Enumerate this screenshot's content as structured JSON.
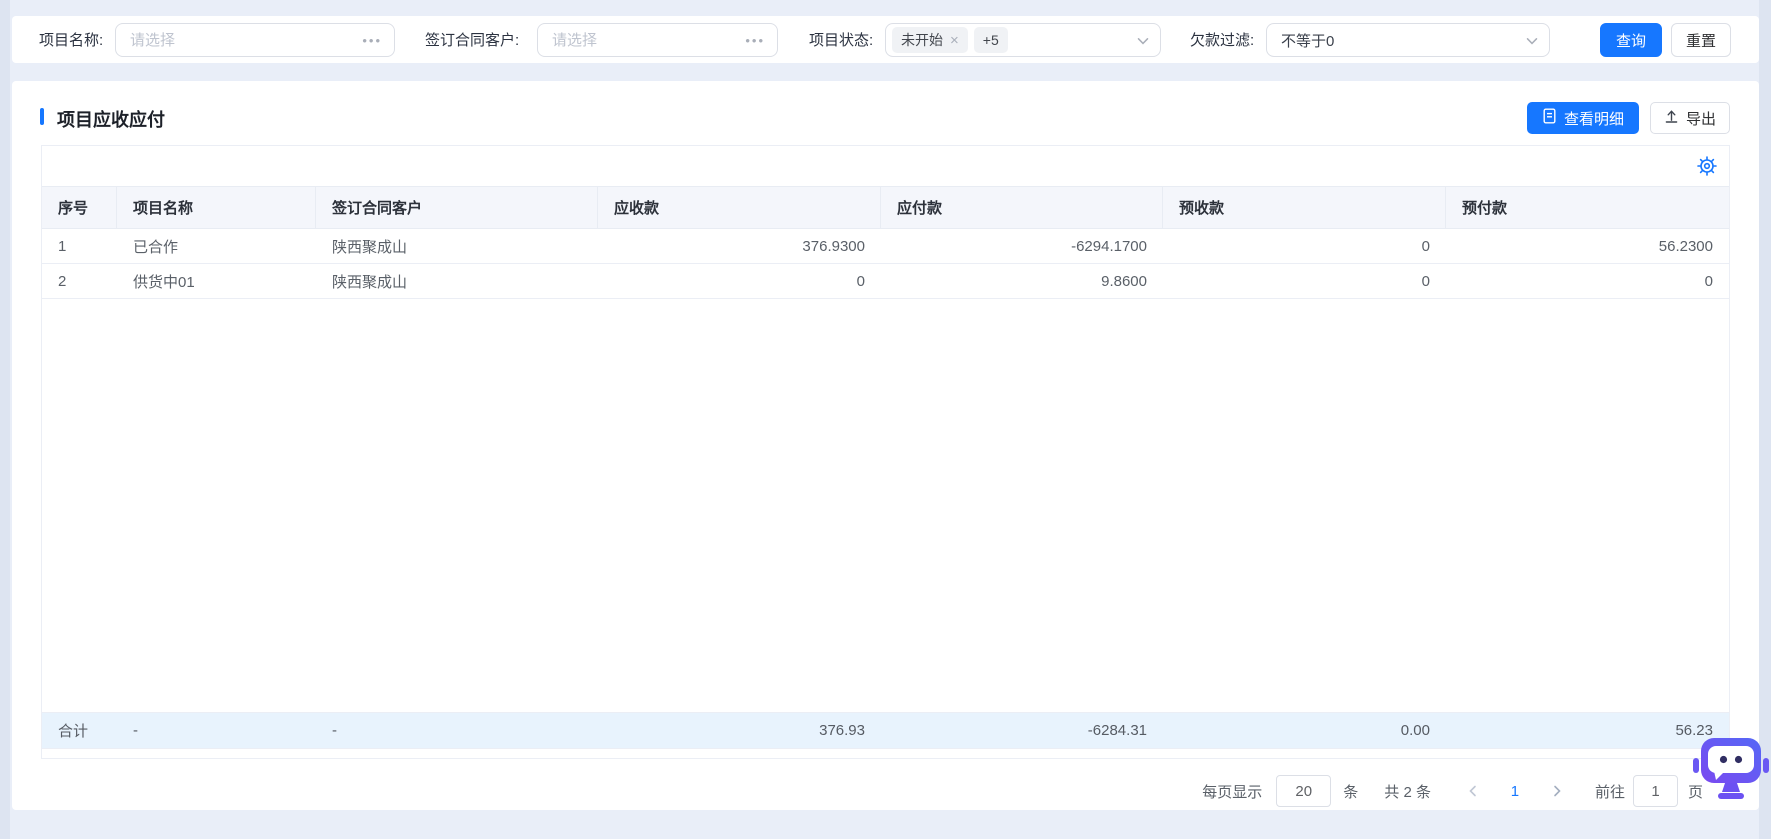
{
  "filters": {
    "project_name": {
      "label": "项目名称:",
      "placeholder": "请选择"
    },
    "contract_customer": {
      "label": "签订合同客户:",
      "placeholder": "请选择"
    },
    "project_status": {
      "label": "项目状态:",
      "tag1": "未开始",
      "tag1_close": "×",
      "tag2": "+5"
    },
    "debt_filter": {
      "label": "欠款过滤:",
      "value": "不等于0"
    },
    "search_button": "查询",
    "reset_button": "重置",
    "more_icon_glyph": "•••"
  },
  "panel": {
    "title": "项目应收应付",
    "view_detail_button": "查看明细",
    "export_button": "导出"
  },
  "table": {
    "columns": [
      "序号",
      "项目名称",
      "签订合同客户",
      "应收款",
      "应付款",
      "预收款",
      "预付款"
    ],
    "rows": [
      [
        "1",
        "已合作",
        "陕西聚成山",
        "376.9300",
        "-6294.1700",
        "0",
        "56.2300"
      ],
      [
        "2",
        "供货中01",
        "陕西聚成山",
        "0",
        "9.8600",
        "0",
        "0"
      ]
    ],
    "summary": [
      "合计",
      "-",
      "-",
      "376.93",
      "-6284.31",
      "0.00",
      "56.23"
    ]
  },
  "pagination": {
    "per_page_label": "每页显示",
    "per_page_value": "20",
    "unit_label": "条",
    "total_label": "共 2 条",
    "current_page": "1",
    "goto_label": "前往",
    "goto_value": "1",
    "page_unit_label": "页"
  },
  "icons": {
    "settings": "gear-icon",
    "select_arrow": "chevron-down-icon",
    "more": "ellipsis-more-icon",
    "view_detail": "document-icon",
    "export": "upload-icon",
    "assistant": "robot-chat-icon"
  },
  "colors": {
    "primary_blue": "#1677ff",
    "summary_row_bg": "#e8f3fd",
    "header_row_bg": "#f4f6fb",
    "tag_bg": "#f0f2f5",
    "robot_purple": "#6c51f2",
    "page_bg": "#e9eef8"
  }
}
